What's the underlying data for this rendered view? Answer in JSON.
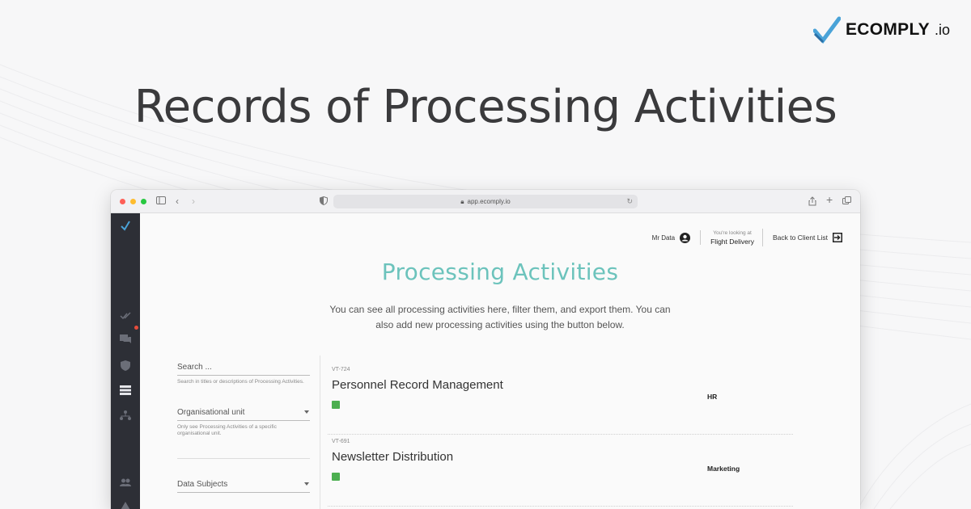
{
  "brand": {
    "name": "ECOMPLY",
    "tld": ".io"
  },
  "headline": "Records of Processing Activities",
  "browser": {
    "url": "app.ecomply.io"
  },
  "topbar": {
    "user_name": "Mr Data",
    "looking_label": "You're looking at",
    "client_name": "Flight Delivery",
    "back_label": "Back to Client List"
  },
  "page": {
    "title": "Processing Activities",
    "description": "You can see all processing activities here, filter them, and export them. You can also add new processing activities using the button below."
  },
  "filters": {
    "search": {
      "placeholder": "Search ...",
      "hint": "Search in titles or descriptions of Processing Activities."
    },
    "org_unit": {
      "label": "Organisational unit",
      "hint": "Only see Processing Activities of a specific organisational unit."
    },
    "data_subjects": {
      "label": "Data Subjects"
    }
  },
  "activities": [
    {
      "code": "VT-724",
      "name": "Personnel Record Management",
      "department": "HR",
      "status_color": "#4caf50"
    },
    {
      "code": "VT-691",
      "name": "Newsletter Distribution",
      "department": "Marketing",
      "status_color": "#4caf50"
    }
  ],
  "colors": {
    "accent": "#6cc3bc",
    "sidebar": "#2d2f36",
    "status_ok": "#4caf50",
    "notification": "#e74c3c"
  },
  "icons": {
    "sidebar": [
      "logo-icon",
      "checkmarks-icon",
      "chat-icon",
      "shield-icon",
      "list-icon",
      "hierarchy-icon",
      "people-icon",
      "warning-icon"
    ]
  }
}
